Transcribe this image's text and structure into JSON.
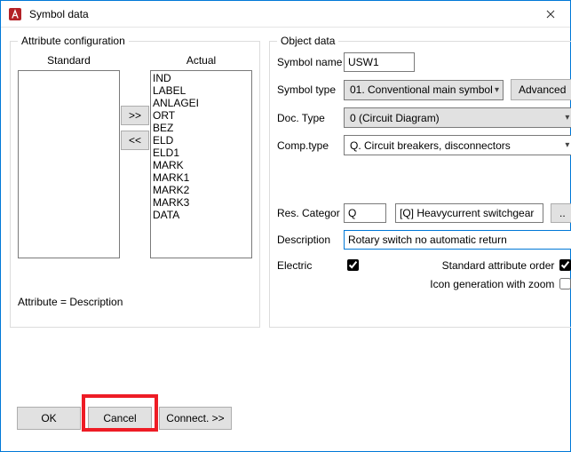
{
  "window": {
    "title": "Symbol data"
  },
  "attr": {
    "legend": "Attribute configuration",
    "standard_header": "Standard",
    "actual_header": "Actual",
    "move_right": ">>",
    "move_left": "<<",
    "status": "Attribute = Description",
    "actual_items": [
      "IND",
      "LABEL",
      "ANLAGEI",
      "ORT",
      "BEZ",
      "ELD",
      "ELD1",
      "MARK",
      "MARK1",
      "MARK2",
      "MARK3",
      "DATA"
    ]
  },
  "obj": {
    "legend": "Object data",
    "symbol_name_label": "Symbol name",
    "symbol_name_value": "USW1",
    "symbol_type_label": "Symbol type",
    "symbol_type_value": "01. Conventional main symbol",
    "advanced_label": "Advanced",
    "doc_type_label": "Doc. Type",
    "doc_type_value": "0 (Circuit Diagram)",
    "comp_type_label": "Comp.type",
    "comp_type_value": "Q. Circuit breakers, disconnectors",
    "res_categor_label": "Res. Categor",
    "res_categor_value": "Q",
    "res_categor_desc": "[Q] Heavycurrent switchgear",
    "res_categor_browse": "..",
    "description_label": "Description",
    "description_value": "Rotary switch no automatic return",
    "electric_label": "Electric",
    "std_attr_order_label": "Standard attribute order",
    "icon_zoom_label": "Icon generation with zoom"
  },
  "buttons": {
    "ok": "OK",
    "cancel": "Cancel",
    "connect": "Connect. >>"
  }
}
